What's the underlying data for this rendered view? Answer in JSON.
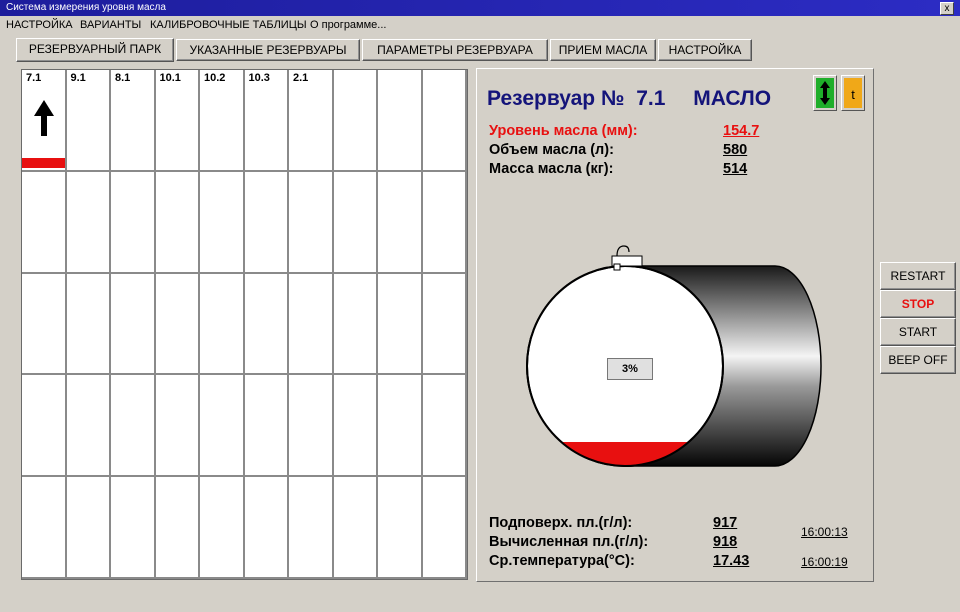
{
  "window": {
    "title": "Система измерения уровня масла",
    "close_label": "x"
  },
  "menu": [
    {
      "label": "НАСТРОЙКА"
    },
    {
      "label": "ВАРИАНТЫ"
    },
    {
      "label": "КАЛИБРОВОЧНЫЕ ТАБЛИЦЫ"
    },
    {
      "label": "О программе..."
    }
  ],
  "tabs": [
    {
      "label": "РЕЗЕРВУАРНЫЙ ПАРК",
      "active": true
    },
    {
      "label": "УКАЗАННЫЕ РЕЗЕРВУАРЫ"
    },
    {
      "label": "ПАРАМЕТРЫ РЕЗЕРВУАРА"
    },
    {
      "label": "ПРИЕМ МАСЛА"
    },
    {
      "label": "НАСТРОЙКА"
    }
  ],
  "tanks_grid": {
    "cells": [
      {
        "label": "7.1",
        "selected": true,
        "level_fraction": 0.03
      },
      {
        "label": "9.1"
      },
      {
        "label": "8.1"
      },
      {
        "label": "10.1"
      },
      {
        "label": "10.2"
      },
      {
        "label": "10.3"
      },
      {
        "label": "2.1"
      }
    ]
  },
  "tank": {
    "title": "Резервуар №",
    "number": "7.1",
    "product": "МАСЛО",
    "level_label": "Уровень масла (мм):",
    "level_value": "154.7",
    "volume_label": "Объем масла (л):",
    "volume_value": "580",
    "mass_label": "Масса масла (кг):",
    "mass_value": "514",
    "fill_percent_label": "3%",
    "fill_fraction": 0.03,
    "surface_density_label": "Подповерх. пл.(г/л):",
    "surface_density_value": "917",
    "surface_time": "16:00:13",
    "calc_density_label": "Вычисленная пл.(г/л):",
    "calc_density_value": "918",
    "temp_label": "Ср.температура(°C):",
    "temp_value": "17.43",
    "temp_time": "16:00:19"
  },
  "side_buttons": [
    {
      "label": "RESTART"
    },
    {
      "label": "STOP"
    },
    {
      "label": "START"
    },
    {
      "label": "BEEP OFF"
    }
  ],
  "colors": {
    "level_red": "#e81010",
    "title_blue": "#14147a",
    "green_icon": "#1fae2a",
    "orange_icon": "#f0a818"
  },
  "icons": {
    "arrows": "up-down-arrows-icon",
    "thermo": "temperature-icon"
  }
}
